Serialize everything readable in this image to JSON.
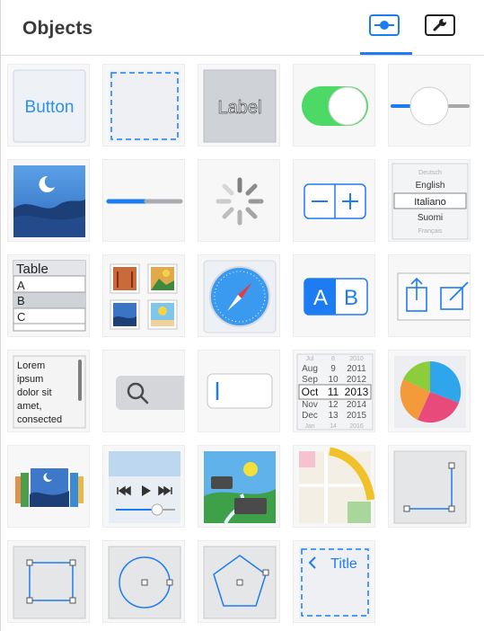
{
  "header": {
    "title": "Objects",
    "tabs": [
      {
        "name": "objects-tab",
        "icon": "slider-circle-icon",
        "active": true
      },
      {
        "name": "wrench-tab",
        "icon": "wrench-icon",
        "active": false
      }
    ]
  },
  "accent": "#1e7cf2",
  "library": {
    "button_label": "Button",
    "label_label": "Label",
    "picker_items": [
      "Deutsch",
      "English",
      "Italiano",
      "Suomi",
      "Français"
    ],
    "table_items": [
      "Table",
      "A",
      "B",
      "C"
    ],
    "segmented_items": [
      "A",
      "B"
    ],
    "textview_lines": [
      "Lorem",
      "ipsum",
      "dolor sit",
      "amet,",
      "consected"
    ],
    "datepicker": {
      "months": [
        "Jul",
        "Aug",
        "Sep",
        "Oct",
        "Nov",
        "Dec",
        "Jan"
      ],
      "days": [
        "8",
        "9",
        "10",
        "11",
        "12",
        "13",
        "14"
      ],
      "years": [
        "2010",
        "2011",
        "2012",
        "2013",
        "2014",
        "2015",
        "2016"
      ]
    },
    "navbar_title": "Title"
  }
}
